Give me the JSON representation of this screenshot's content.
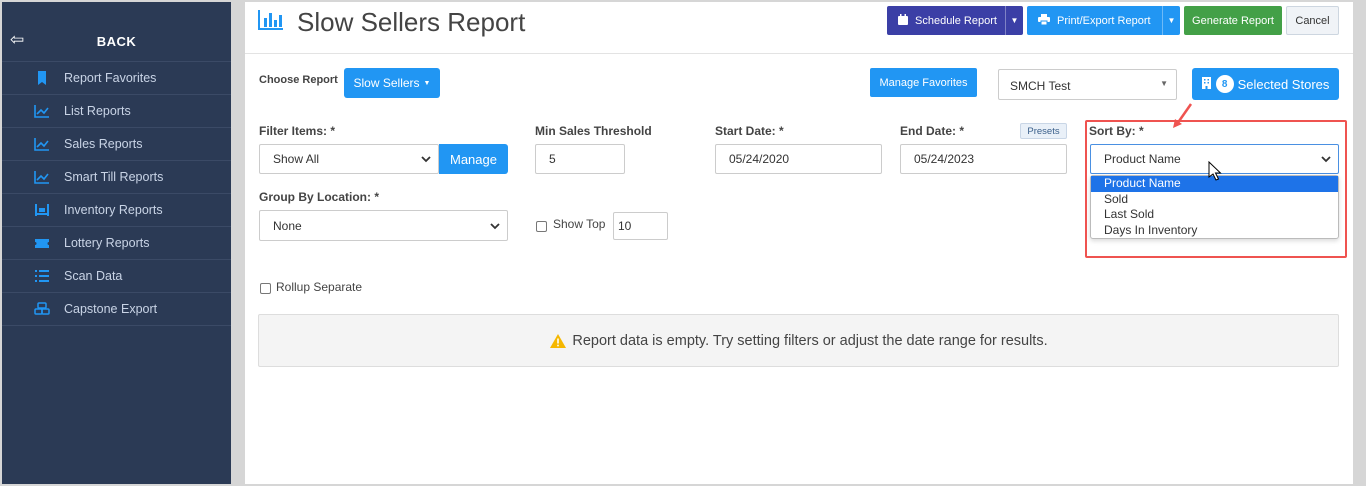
{
  "sidebar": {
    "back_label": "BACK",
    "items": [
      {
        "label": "Report Favorites",
        "icon": "bookmark-icon"
      },
      {
        "label": "List Reports",
        "icon": "line-chart-icon"
      },
      {
        "label": "Sales Reports",
        "icon": "line-chart-icon"
      },
      {
        "label": "Smart Till Reports",
        "icon": "line-chart-icon"
      },
      {
        "label": "Inventory Reports",
        "icon": "pallet-icon"
      },
      {
        "label": "Lottery Reports",
        "icon": "ticket-icon"
      },
      {
        "label": "Scan Data",
        "icon": "list-icon"
      },
      {
        "label": "Capstone Export",
        "icon": "cubes-icon"
      }
    ]
  },
  "header": {
    "title": "Slow Sellers Report",
    "schedule_label": "Schedule Report",
    "print_label": "Print/Export Report",
    "generate_label": "Generate Report",
    "cancel_label": "Cancel"
  },
  "report_bar": {
    "choose_label": "Choose Report",
    "report_value": "Slow Sellers",
    "manage_favorites_label": "Manage Favorites",
    "store_value": "SMCH Test",
    "selected_count": "8",
    "selected_stores_label": "Selected Stores"
  },
  "filters": {
    "filter_items_label": "Filter Items: *",
    "filter_items_value": "Show All",
    "manage_label": "Manage",
    "min_sales_label": "Min Sales Threshold",
    "min_sales_value": "5",
    "start_date_label": "Start Date: *",
    "start_date_value": "05/24/2020",
    "end_date_label": "End Date: *",
    "end_date_value": "05/24/2023",
    "presets_label": "Presets",
    "sort_by_label": "Sort By: *",
    "sort_by_value": "Product Name",
    "sort_options": [
      "Product Name",
      "Sold",
      "Last Sold",
      "Days In Inventory"
    ],
    "group_by_label": "Group By Location: *",
    "group_by_value": "None",
    "show_top_label": "Show Top",
    "show_top_value": "10",
    "rollup_label": "Rollup Separate"
  },
  "empty_message": "Report data is empty. Try setting filters or adjust the date range for results.",
  "colors": {
    "sidebar_bg": "#2b3a55",
    "primary": "#2196f3",
    "schedule": "#3b3fa6",
    "generate": "#43a047",
    "highlight": "#ef5350",
    "warning": "#f5b700"
  }
}
